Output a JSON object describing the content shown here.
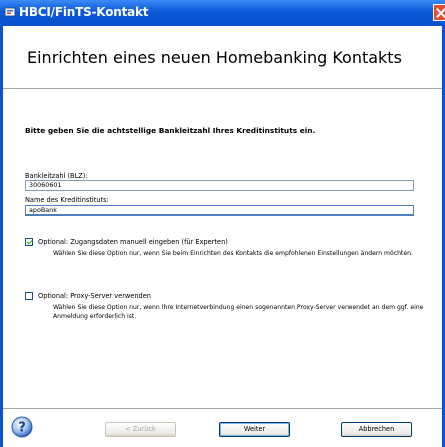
{
  "window": {
    "title": "HBCI/FinTS-Kontakt"
  },
  "header": {
    "title": "Einrichten eines neuen Homebanking Kontakts"
  },
  "form": {
    "instruction": "Bitte geben Sie die achtstellige Bankleitzahl Ihres Kreditinstituts ein.",
    "blz_label": "Bankleitzahl (BLZ):",
    "blz_value": "30060601",
    "bank_label": "Name des Kreditinstituts:",
    "bank_value": "apoBank"
  },
  "options": [
    {
      "label": "Optional: Zugangsdaten manuell eingeben (für Experten)",
      "checked": true,
      "description": "Wählen Sie diese Option nur, wenn Sie beim Einrichten des Kontakts die empfohlenen Einstellungen ändern möchten."
    },
    {
      "label": "Optional: Proxy-Server verwenden",
      "checked": false,
      "description": "Wählen Sie diese Option nur, wenn Ihre Internetverbindung einen sogenannten Proxy-Server verwendet an dem ggf. eine Anmeldung erforderlich ist."
    }
  ],
  "buttons": {
    "back": "< Zurück",
    "next": "Weiter",
    "cancel": "Abbrechen"
  },
  "icons": {
    "title": "window-app-icon",
    "help": "help-icon",
    "close": "close-icon"
  },
  "colors": {
    "titlebar": "#0a5ad9",
    "close": "#e0502c",
    "checkmark": "#21a121"
  }
}
